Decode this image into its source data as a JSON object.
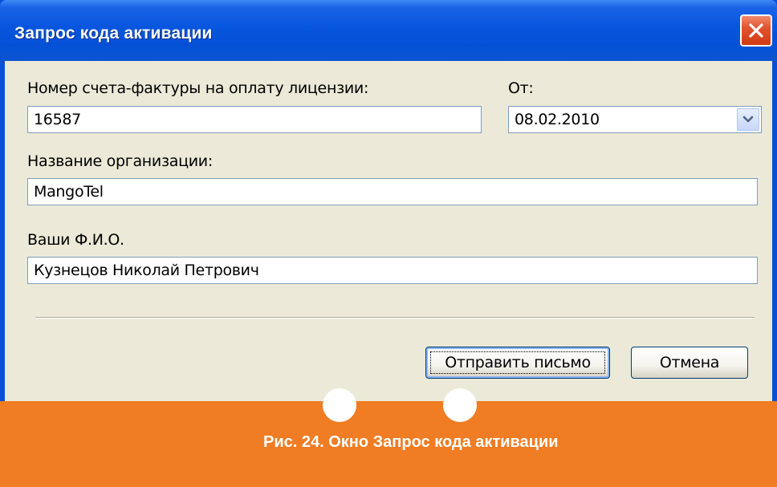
{
  "window": {
    "title": "Запрос кода активации",
    "colors": {
      "titlebar": "#0551d6",
      "client": "#ece9d8",
      "close": "#e2542e"
    }
  },
  "form": {
    "invoice_label": "Номер счета-фактуры на оплату лицензии:",
    "invoice_value": "16587",
    "date_label": "От:",
    "date_value": "08.02.2010",
    "org_label": "Название организации:",
    "org_value": "MangoTel",
    "name_label": "Ваши Ф.И.О.",
    "name_value": "Кузнецов Николай Петрович"
  },
  "buttons": {
    "send_label": "Отправить письмо",
    "cancel_label": "Отмена"
  },
  "icons": [
    "close-icon",
    "chevron-down-icon"
  ],
  "banner": {
    "caption": "Рис. 24. Окно Запрос кода активации",
    "color": "#f07c23"
  }
}
